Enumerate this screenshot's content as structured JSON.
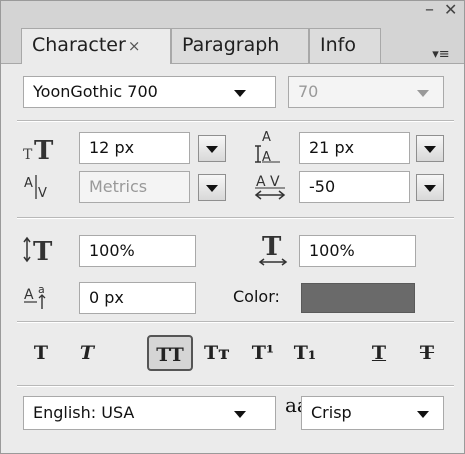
{
  "tabs": [
    {
      "label": "Character",
      "close": "×",
      "active": true
    },
    {
      "label": "Paragraph",
      "active": false
    },
    {
      "label": "Info",
      "active": false
    }
  ],
  "window_controls": {
    "minimize": "–",
    "close": "✕",
    "menu": "▾≡"
  },
  "font": {
    "family": "YoonGothic 700",
    "style": "70"
  },
  "size": {
    "font_size": "12 px",
    "leading": "21 px"
  },
  "kerning": {
    "kerning": "Metrics",
    "tracking": "-50"
  },
  "scale": {
    "vertical": "100%",
    "horizontal": "100%"
  },
  "baseline": {
    "baseline_shift": "0 px",
    "color_label": "Color:",
    "color_value": "#6a6a6a"
  },
  "style_buttons": [
    {
      "name": "faux-bold",
      "glyph": "T",
      "pressed": false
    },
    {
      "name": "faux-italic",
      "glyph": "T",
      "pressed": false
    },
    {
      "name": "all-caps",
      "glyph": "TT",
      "pressed": true
    },
    {
      "name": "small-caps",
      "glyph": "Tт",
      "pressed": false
    },
    {
      "name": "superscript",
      "glyph": "T¹",
      "pressed": false
    },
    {
      "name": "subscript",
      "glyph": "T₁",
      "pressed": false
    },
    {
      "name": "underline",
      "glyph": "T",
      "pressed": false
    },
    {
      "name": "strikethrough",
      "glyph": "T",
      "pressed": false
    }
  ],
  "language": {
    "value": "English: USA",
    "aa_icon": "aa",
    "antialias": "Crisp"
  }
}
